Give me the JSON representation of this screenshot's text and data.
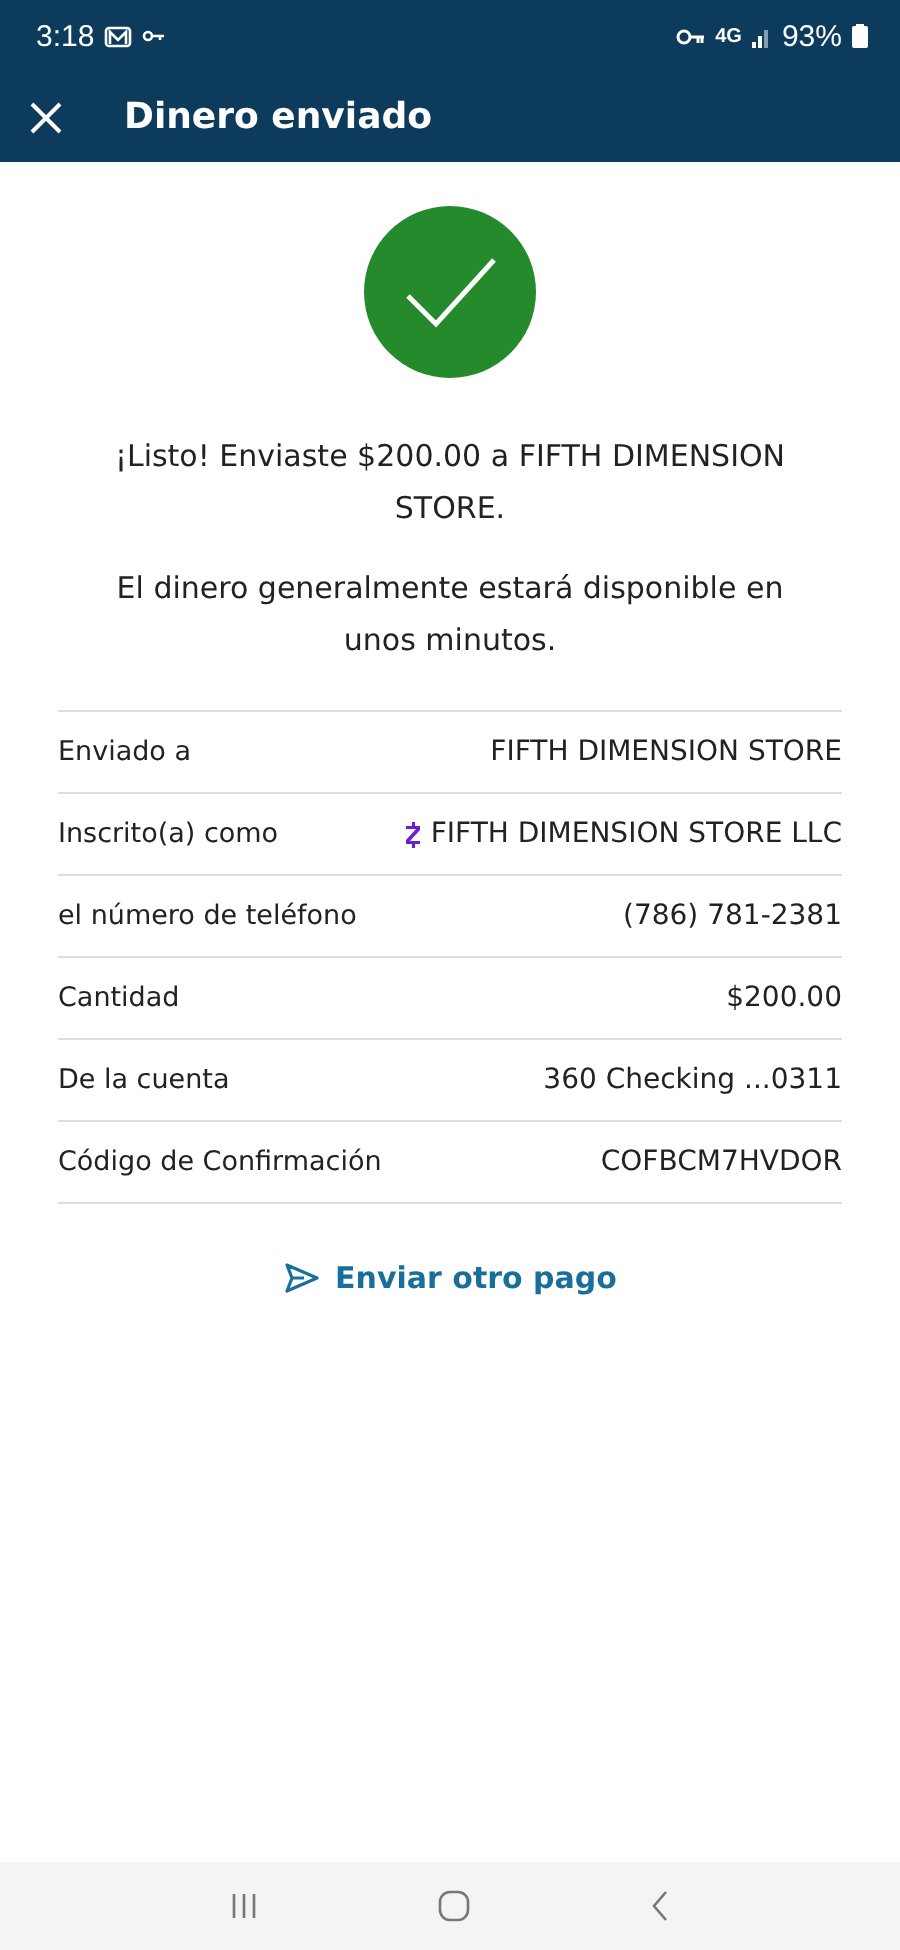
{
  "status_bar": {
    "time": "3:18",
    "network": "4G",
    "battery": "93%"
  },
  "app_bar": {
    "title": "Dinero enviado"
  },
  "message": "¡Listo! Enviaste $200.00 a FIFTH DIMENSION STORE.",
  "note": "El dinero generalmente estará disponible en unos minutos.",
  "details": [
    {
      "label": "Enviado a",
      "value": "FIFTH DIMENSION STORE",
      "kind": "plain"
    },
    {
      "label": "Inscrito(a) como",
      "value": "FIFTH DIMENSION STORE LLC",
      "kind": "zelle"
    },
    {
      "label": "el número de teléfono",
      "value": "(786) 781-2381",
      "kind": "plain"
    },
    {
      "label": "Cantidad",
      "value": "$200.00",
      "kind": "plain"
    },
    {
      "label": "De la cuenta",
      "value": "360 Checking ...0311",
      "kind": "plain"
    },
    {
      "label": "Código de Confirmación",
      "value": "COFBCM7HVDOR",
      "kind": "plain"
    }
  ],
  "action": "Enviar otro pago"
}
